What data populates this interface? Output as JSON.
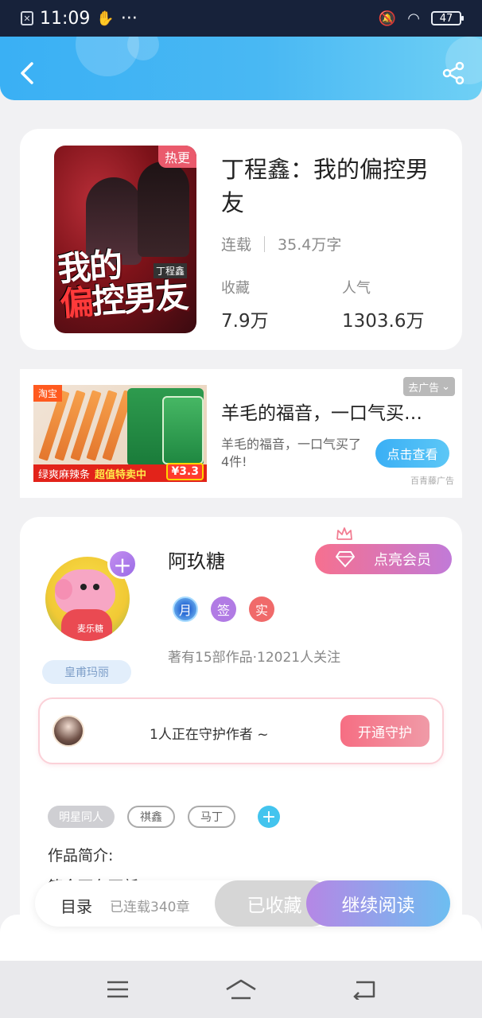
{
  "status_bar": {
    "time": "11:09",
    "more": "···",
    "battery": "47"
  },
  "book": {
    "badge": "热更",
    "title": "丁程鑫：我的偏控男友",
    "cover_title_line1": "我的",
    "cover_title_line2a": "偏",
    "cover_title_line2b": "控男友",
    "cover_label": "丁程鑫",
    "status": "连载",
    "word_count": "35.4万字",
    "favorites_label": "收藏",
    "favorites_value": "7.9万",
    "popularity_label": "人气",
    "popularity_value": "1303.6万"
  },
  "ad": {
    "close_label": "去广告",
    "image_tag": "淘宝",
    "image_caption_a": "绿爽麻辣条",
    "image_caption_b": "超值特卖中",
    "image_price": "¥3.3",
    "title": "羊毛的福音，一口气买了4件！",
    "description": "羊毛的福音，一口气买了4件!",
    "button": "点击查看",
    "source": "百青藤广告"
  },
  "author": {
    "name": "阿玖糖",
    "avatar_caption": "麦乐糖",
    "tag": "皇甫玛丽",
    "vip_button": "点亮会员",
    "badges": [
      "月",
      "签",
      "实"
    ],
    "stats": "著有15部作品·12021人关注",
    "guard_text": "1人正在守护作者 ~",
    "guard_button": "开通守护",
    "tags": [
      "明星同人",
      "祺鑫",
      "马丁"
    ],
    "intro_label": "作品简介:",
    "intro_text": "第今下车面新"
  },
  "bottom_bar": {
    "toc": "目录",
    "chapter_count": "已连载340章",
    "collected": "已收藏",
    "continue": "继续阅读"
  },
  "colors": {
    "header_blue": "#3ab0f4",
    "accent_pink": "#f6708f",
    "accent_purple": "#b587e5",
    "tag_blue": "#43c4ee"
  }
}
